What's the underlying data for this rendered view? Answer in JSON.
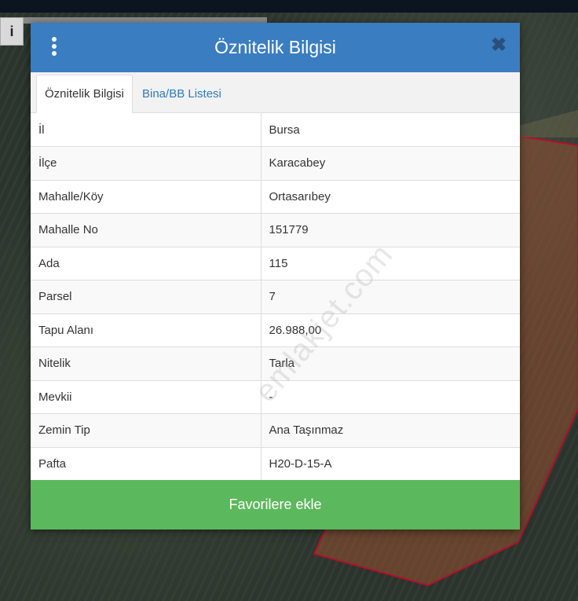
{
  "modal": {
    "title": "Öznitelik Bilgisi",
    "close_glyph": "✖",
    "menu_icon": "vertical-dots-icon"
  },
  "tabs": [
    {
      "label": "Öznitelik Bilgisi",
      "active": true
    },
    {
      "label": "Bina/BB Listesi",
      "active": false
    }
  ],
  "rows": [
    {
      "key": "İl",
      "value": "Bursa"
    },
    {
      "key": "İlçe",
      "value": "Karacabey"
    },
    {
      "key": "Mahalle/Köy",
      "value": "Ortasarıbey"
    },
    {
      "key": "Mahalle No",
      "value": "151779"
    },
    {
      "key": "Ada",
      "value": "115"
    },
    {
      "key": "Parsel",
      "value": "7"
    },
    {
      "key": "Tapu Alanı",
      "value": "26.988,00"
    },
    {
      "key": "Nitelik",
      "value": "Tarla"
    },
    {
      "key": "Mevkii",
      "value": "-"
    },
    {
      "key": "Zemin Tip",
      "value": "Ana Taşınmaz"
    },
    {
      "key": "Pafta",
      "value": "H20-D-15-A"
    }
  ],
  "favorite_button": "Favorilere ekle",
  "info_button": "i",
  "watermark": "emlakjet.com",
  "colors": {
    "header": "#3a7dc1",
    "favorite": "#5cb85c",
    "parcel_outline": "#b0102a"
  }
}
